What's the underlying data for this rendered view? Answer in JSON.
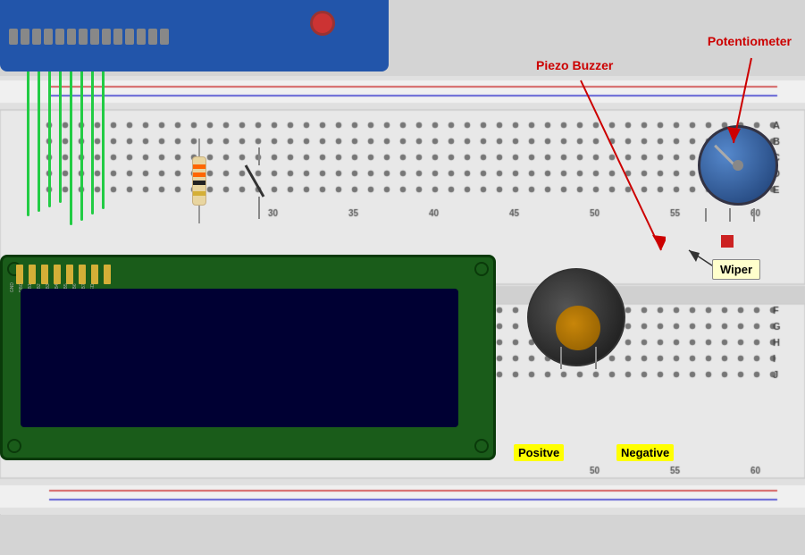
{
  "labels": {
    "piezo_buzzer": "Piezo Buzzer",
    "potentiometer": "Potentiometer",
    "wiper": "Wiper",
    "positive": "Positve",
    "negative": "Negative"
  },
  "breadboard": {
    "numbers_top": [
      "30",
      "35",
      "40",
      "45",
      "50",
      "55",
      "60"
    ],
    "numbers_bottom": [
      "50",
      "55",
      "60"
    ],
    "col_letters": [
      "A",
      "B",
      "C",
      "D",
      "E",
      "F",
      "G",
      "H",
      "I",
      "J"
    ]
  },
  "colors": {
    "arduino": "#2255aa",
    "breadboard_bg": "#e0e0e0",
    "lcd_bg": "#1a5c1a",
    "lcd_screen": "#000033",
    "wire_green": "#22cc44",
    "label_bg": "#ffff00",
    "arrow_color": "#cc0000"
  }
}
